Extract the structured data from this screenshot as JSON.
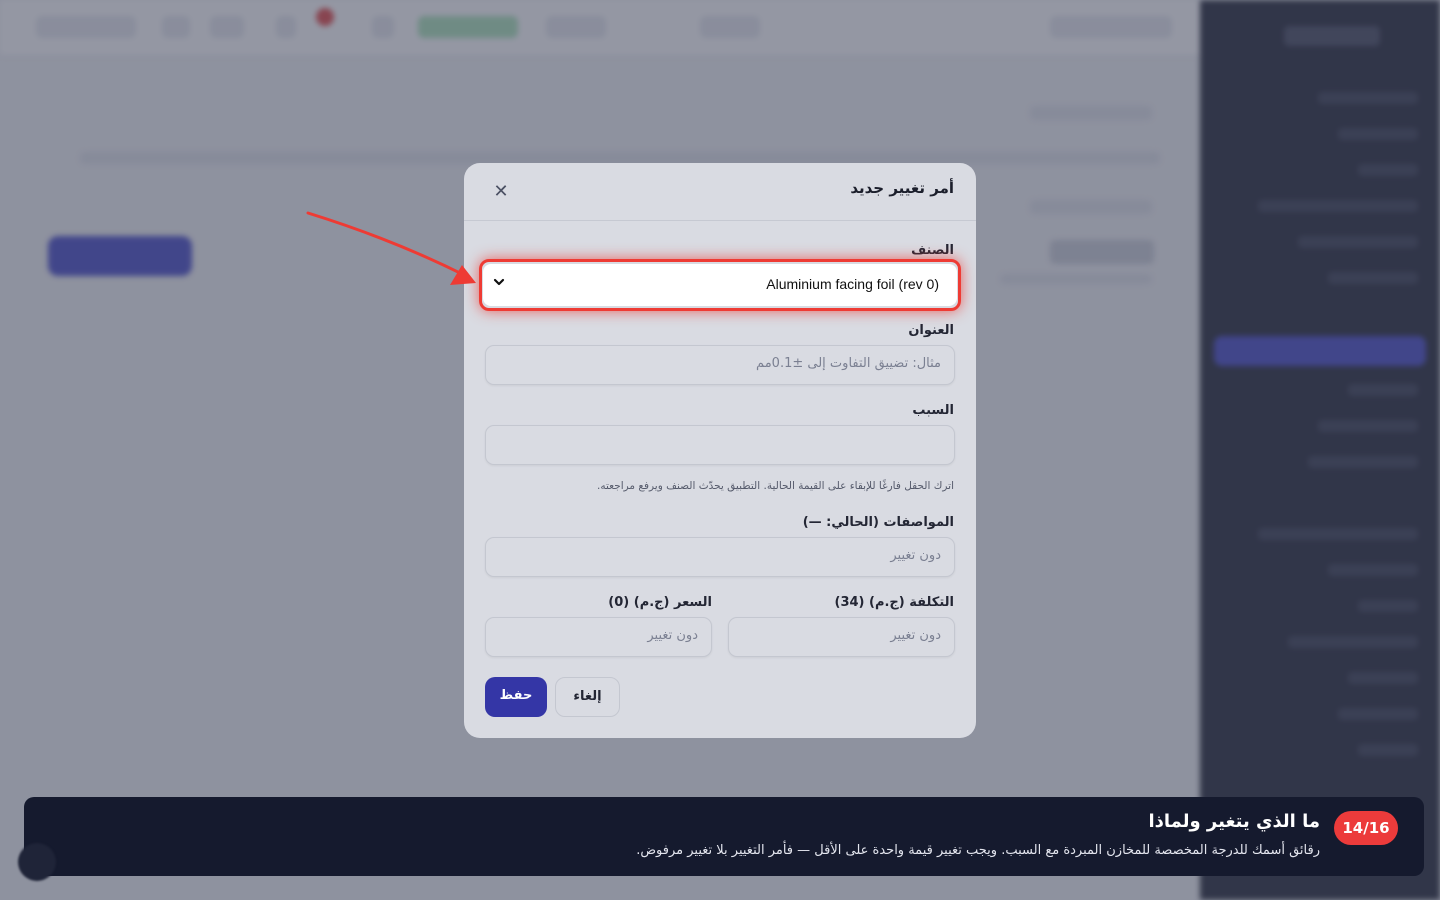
{
  "modal": {
    "title": "أمر تغيير جديد",
    "close_icon": "close-icon",
    "item_label": "الصنف",
    "item_value": "Aluminium facing foil (rev 0)",
    "subject_label": "العنوان",
    "subject_placeholder": "مثال: تضييق التفاوت إلى ±0.1مم",
    "reason_label": "السبب",
    "hint": "اترك الحقل فارغًا للإبقاء على القيمة الحالية. التطبيق يحدّث الصنف ويرفع مراجعته.",
    "specs_label": "المواصفات (الحالي: —)",
    "specs_placeholder": "دون تغيير",
    "cost_label": "التكلفة (ج.م) (34)",
    "cost_placeholder": "دون تغيير",
    "price_label": "السعر (ج.م) (0)",
    "price_placeholder": "دون تغيير",
    "save_label": "حفظ",
    "cancel_label": "إلغاء"
  },
  "tour": {
    "step": "14/16",
    "title": "ما الذي يتغير ولماذا",
    "description": "رقائق أسمك للدرجة المخصصة للمخازن المبردة مع السبب. ويجب تغيير قيمة واحدة على الأقل — فأمر التغيير بلا تغيير مرفوض."
  },
  "colors": {
    "accent": "#3436a6",
    "highlight": "#ee3b34",
    "sidebar": "#141829",
    "tour_badge": "#ec3b3b"
  }
}
